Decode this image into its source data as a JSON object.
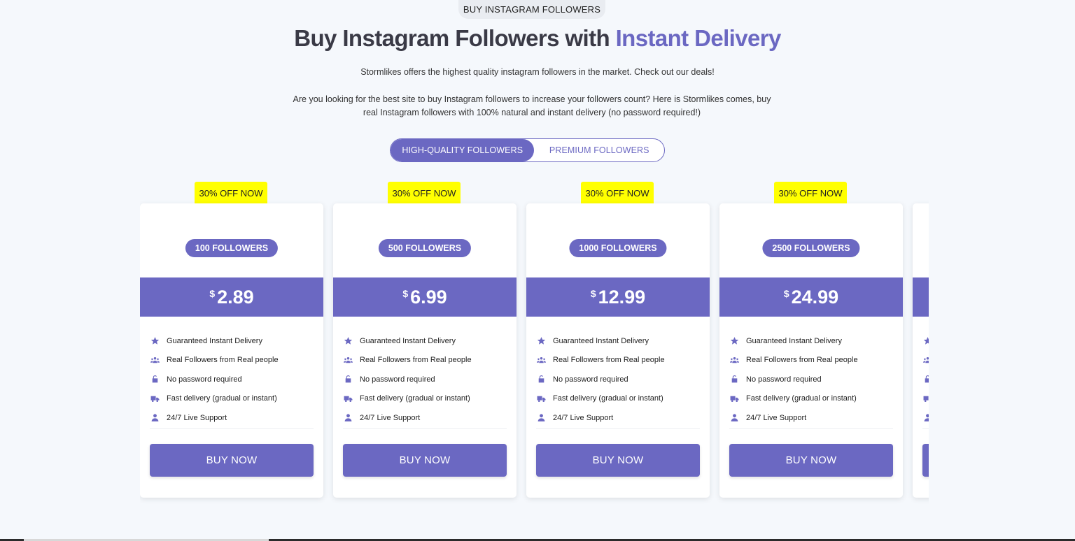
{
  "eyebrow": "BUY INSTAGRAM FOLLOWERS",
  "headline": {
    "main": "Buy Instagram Followers with",
    "accent": "Instant Delivery"
  },
  "intro": "Stormlikes offers the highest quality instagram followers in the market. Check out our deals!",
  "description": "Are you looking for the best site to buy Instagram followers to increase your followers count? Here is Stormlikes comes, buy real Instagram followers with 100% natural and instant delivery (no password required!)",
  "toggle": {
    "active": "HIGH-QUALITY FOLLOWERS",
    "inactive": "PREMIUM FOLLOWERS"
  },
  "colors": {
    "accent": "#6b68c2",
    "badge": "#ffff00",
    "background": "#f5f8fc"
  },
  "features": [
    {
      "icon": "star-icon",
      "label": "Guaranteed Instant Delivery"
    },
    {
      "icon": "users-icon",
      "label": "Real Followers from Real people"
    },
    {
      "icon": "unlock-icon",
      "label": "No password required"
    },
    {
      "icon": "truck-icon",
      "label": "Fast delivery (gradual or instant)"
    },
    {
      "icon": "user-icon",
      "label": "24/7 Live Support"
    }
  ],
  "plans": [
    {
      "badge": "30% OFF NOW",
      "quantity": "100 FOLLOWERS",
      "currency": "$",
      "price": "2.89",
      "cta": "BUY NOW"
    },
    {
      "badge": "30% OFF NOW",
      "quantity": "500 FOLLOWERS",
      "currency": "$",
      "price": "6.99",
      "cta": "BUY NOW"
    },
    {
      "badge": "30% OFF NOW",
      "quantity": "1000 FOLLOWERS",
      "currency": "$",
      "price": "12.99",
      "cta": "BUY NOW"
    },
    {
      "badge": "30% OFF NOW",
      "quantity": "2500 FOLLOWERS",
      "currency": "$",
      "price": "24.99",
      "cta": "BUY NOW"
    },
    {
      "badge": "",
      "quantity": "",
      "currency": "",
      "price": "",
      "cta": ""
    }
  ]
}
